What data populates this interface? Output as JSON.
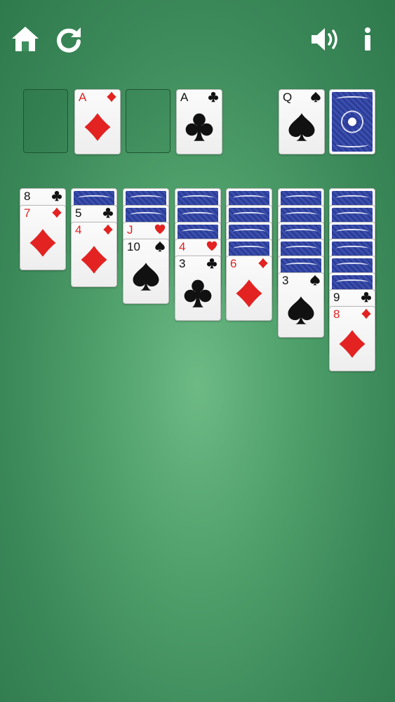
{
  "toolbar": {
    "home_icon": "home-icon",
    "restart_icon": "restart-icon",
    "sound_icon": "sound-icon",
    "info_icon": "info-icon"
  },
  "colors": {
    "felt": "#3f8f5e",
    "red_suit": "#e32222",
    "black_suit": "#111111",
    "card_back": "#2f3f9a"
  },
  "foundations": [
    {
      "empty": true
    },
    {
      "rank": "A",
      "suit": "diamonds",
      "color": "red"
    },
    {
      "empty": true
    },
    {
      "rank": "A",
      "suit": "clubs",
      "color": "black"
    }
  ],
  "waste": {
    "rank": "Q",
    "suit": "spades",
    "color": "black"
  },
  "stock": {
    "face_down": true
  },
  "tableau": [
    {
      "hidden": 0,
      "cards": [
        {
          "rank": "8",
          "suit": "clubs",
          "color": "black"
        },
        {
          "rank": "7",
          "suit": "diamonds",
          "color": "red"
        }
      ]
    },
    {
      "hidden": 1,
      "cards": [
        {
          "rank": "5",
          "suit": "clubs",
          "color": "black"
        },
        {
          "rank": "4",
          "suit": "diamonds",
          "color": "red"
        }
      ]
    },
    {
      "hidden": 2,
      "cards": [
        {
          "rank": "J",
          "suit": "hearts",
          "color": "red"
        },
        {
          "rank": "10",
          "suit": "spades",
          "color": "black"
        }
      ]
    },
    {
      "hidden": 3,
      "cards": [
        {
          "rank": "4",
          "suit": "hearts",
          "color": "red"
        },
        {
          "rank": "3",
          "suit": "clubs",
          "color": "black"
        }
      ]
    },
    {
      "hidden": 4,
      "cards": [
        {
          "rank": "6",
          "suit": "diamonds",
          "color": "red"
        }
      ]
    },
    {
      "hidden": 5,
      "cards": [
        {
          "rank": "3",
          "suit": "spades",
          "color": "black"
        }
      ]
    },
    {
      "hidden": 6,
      "cards": [
        {
          "rank": "9",
          "suit": "clubs",
          "color": "black"
        },
        {
          "rank": "8",
          "suit": "diamonds",
          "color": "red"
        }
      ]
    }
  ]
}
